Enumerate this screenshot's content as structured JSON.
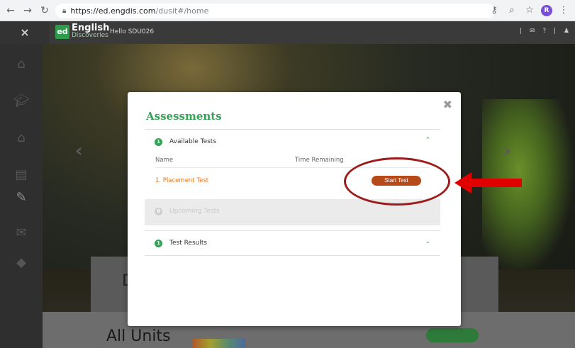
{
  "browser": {
    "url_host": "https://ed.engdis.com",
    "url_path": "/dusit#/home",
    "profile_initial": "R"
  },
  "app": {
    "logo_mark": "ed",
    "logo_english": "English",
    "logo_discoveries": "Discoveries",
    "greeting": "Hello SDU026",
    "close_symbol": "×",
    "header_tools": "| ✉ ? | ♟"
  },
  "background": {
    "panel_initial": "D",
    "all_units": "All Units"
  },
  "modal": {
    "title": "Assessments",
    "close_symbol": "✖",
    "available": {
      "badge": "1",
      "label": "Available Tests",
      "col_name": "Name",
      "col_time": "Time Remaining",
      "tests": [
        {
          "name": "1. Placement Test",
          "action": "Start Test"
        }
      ]
    },
    "upcoming": {
      "badge": "0",
      "label": "Upcoming Tests"
    },
    "results": {
      "badge": "1",
      "label": "Test Results"
    }
  },
  "colors": {
    "accent_green": "#35a356",
    "test_orange": "#e5761f",
    "start_button": "#b84a1a",
    "annotation_red": "#e00000"
  }
}
